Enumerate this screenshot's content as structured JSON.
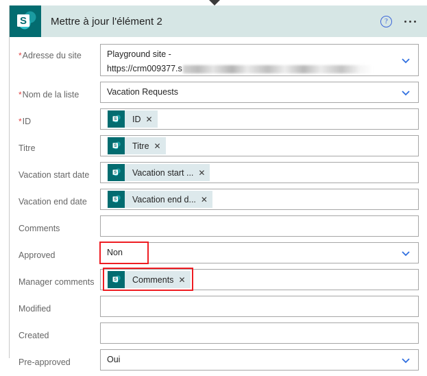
{
  "window": {
    "caret_icon": "triangle-down-icon"
  },
  "header": {
    "logo_icon": "sharepoint-logo-icon",
    "title": "Mettre à jour l'élément 2",
    "help_icon": "help-question-icon",
    "help_glyph": "?",
    "more_icon": "ellipsis-more-icon"
  },
  "colors": {
    "sharepoint_teal": "#036c70",
    "header_band": "#d6e6e5",
    "accent_blue": "#3a64d8",
    "required_red": "#e04343",
    "annotation_red": "#ee1c22",
    "token_bg": "#dde9ec",
    "label_gray": "#666666"
  },
  "form": {
    "rows": [
      {
        "label": "Adresse du site",
        "required": true,
        "type": "dropdown-two-line",
        "line1": "Playground site -",
        "line2": "https://crm009377.s",
        "redacted": true,
        "chevron_icon": "chevron-down-icon",
        "name": "site-address"
      },
      {
        "label": "Nom de la liste",
        "required": true,
        "type": "dropdown",
        "value": "Vacation Requests",
        "chevron_icon": "chevron-down-icon",
        "name": "list-name"
      },
      {
        "label": "ID",
        "required": true,
        "type": "token",
        "token": "ID",
        "token_icon": "sharepoint-token-icon",
        "remove_glyph": "✕",
        "name": "id"
      },
      {
        "label": "Titre",
        "required": false,
        "type": "token",
        "token": "Titre",
        "token_icon": "sharepoint-token-icon",
        "remove_glyph": "✕",
        "name": "titre"
      },
      {
        "label": "Vacation start date",
        "required": false,
        "type": "token",
        "token": "Vacation start ...",
        "token_icon": "sharepoint-token-icon",
        "remove_glyph": "✕",
        "name": "vacation-start-date"
      },
      {
        "label": "Vacation end date",
        "required": false,
        "type": "token",
        "token": "Vacation end d...",
        "token_icon": "sharepoint-token-icon",
        "remove_glyph": "✕",
        "name": "vacation-end-date"
      },
      {
        "label": "Comments",
        "required": false,
        "type": "text",
        "value": "",
        "name": "comments"
      },
      {
        "label": "Approved",
        "required": false,
        "type": "dropdown",
        "value": "Non",
        "chevron_icon": "chevron-down-icon",
        "highlighted": true,
        "name": "approved"
      },
      {
        "label": "Manager comments",
        "required": false,
        "type": "token",
        "token": "Comments",
        "token_icon": "sharepoint-token-icon",
        "remove_glyph": "✕",
        "highlighted": true,
        "name": "manager-comments"
      },
      {
        "label": "Modified",
        "required": false,
        "type": "text",
        "value": "",
        "name": "modified"
      },
      {
        "label": "Created",
        "required": false,
        "type": "text",
        "value": "",
        "name": "created"
      },
      {
        "label": "Pre-approved",
        "required": false,
        "type": "dropdown",
        "value": "Oui",
        "chevron_icon": "chevron-down-icon",
        "name": "pre-approved"
      }
    ]
  }
}
